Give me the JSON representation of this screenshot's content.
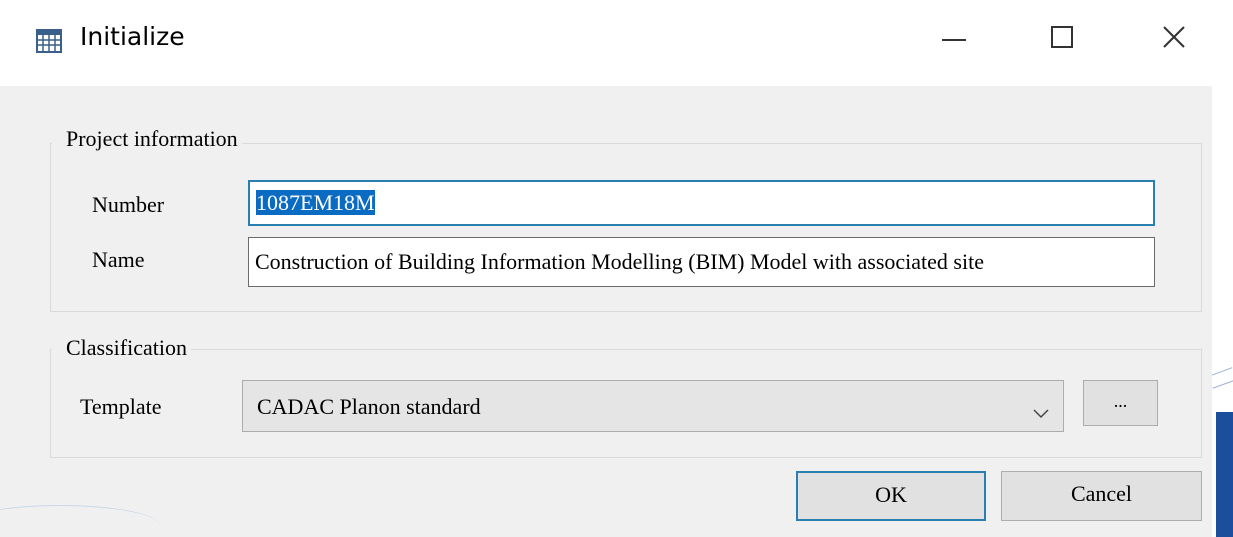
{
  "window": {
    "title": "Initialize",
    "icon": "table-grid-icon",
    "controls": {
      "minimize": "minimize-icon",
      "maximize": "maximize-icon",
      "close": "close-icon"
    }
  },
  "project_information": {
    "legend": "Project information",
    "number_label": "Number",
    "number_value": "1087EM18M",
    "name_label": "Name",
    "name_value": "Construction of Building Information Modelling (BIM) Model with associated site"
  },
  "classification": {
    "legend": "Classification",
    "template_label": "Template",
    "template_value": "CADAC Planon standard",
    "browse_label": "..."
  },
  "buttons": {
    "ok": "OK",
    "cancel": "Cancel"
  },
  "colors": {
    "focus_border": "#2a7fb0",
    "selection": "#0a6bc2",
    "dialog_bg": "#f0f0f0"
  }
}
